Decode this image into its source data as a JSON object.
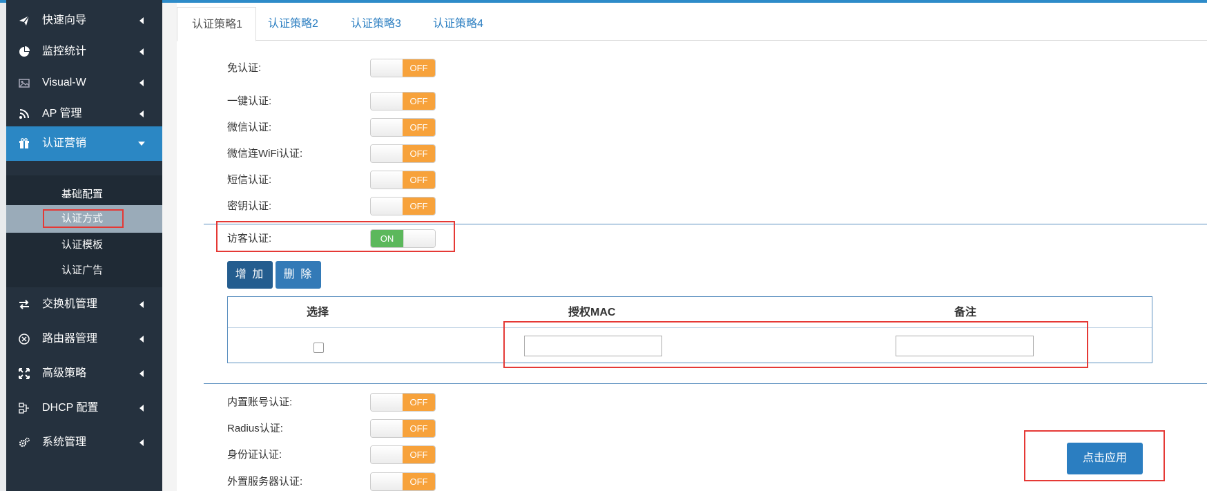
{
  "sidebar": {
    "items": [
      {
        "label": "快速向导",
        "icon": "paper-plane-icon"
      },
      {
        "label": "监控统计",
        "icon": "pie-chart-icon"
      },
      {
        "label": "Visual-W",
        "icon": "image-icon"
      },
      {
        "label": "AP 管理",
        "icon": "rss-icon"
      },
      {
        "label": "认证营销",
        "icon": "gift-icon"
      },
      {
        "label": "交换机管理",
        "icon": "exchange-icon"
      },
      {
        "label": "路由器管理",
        "icon": "router-icon"
      },
      {
        "label": "高级策略",
        "icon": "arrows-icon"
      },
      {
        "label": "DHCP 配置",
        "icon": "sitemap-icon"
      },
      {
        "label": "系统管理",
        "icon": "gears-icon"
      }
    ],
    "active_item": "认证营销",
    "submenu": [
      "基础配置",
      "认证方式",
      "认证模板",
      "认证广告"
    ],
    "selected_submenu": "认证方式"
  },
  "tabs": [
    "认证策略1",
    "认证策略2",
    "认证策略3",
    "认证策略4"
  ],
  "active_tab": "认证策略1",
  "auth_options": {
    "free": {
      "label": "免认证:",
      "state": "OFF"
    },
    "one_key": {
      "label": "一键认证:",
      "state": "OFF"
    },
    "wechat": {
      "label": "微信认证:",
      "state": "OFF"
    },
    "wechat_wifi": {
      "label": "微信连WiFi认证:",
      "state": "OFF"
    },
    "sms": {
      "label": "短信认证:",
      "state": "OFF"
    },
    "key": {
      "label": "密钥认证:",
      "state": "OFF"
    },
    "guest": {
      "label": "访客认证:",
      "state": "ON"
    },
    "builtin_account": {
      "label": "内置账号认证:",
      "state": "OFF"
    },
    "radius": {
      "label": "Radius认证:",
      "state": "OFF"
    },
    "id_card": {
      "label": "身份证认证:",
      "state": "OFF"
    },
    "external_server": {
      "label": "外置服务器认证:",
      "state": "OFF"
    }
  },
  "guest_table": {
    "add_label": "增 加",
    "delete_label": "删 除",
    "headers": [
      "选择",
      "授权MAC",
      "备注"
    ],
    "row": {
      "checked": false,
      "mac": "",
      "note": ""
    }
  },
  "apply_label": "点击应用",
  "colors": {
    "sidebar_bg": "#25313e",
    "accent": "#2b87c4",
    "toggle_off": "#f7a23b",
    "toggle_on": "#5cb85c",
    "highlight_box": "#e53935"
  }
}
